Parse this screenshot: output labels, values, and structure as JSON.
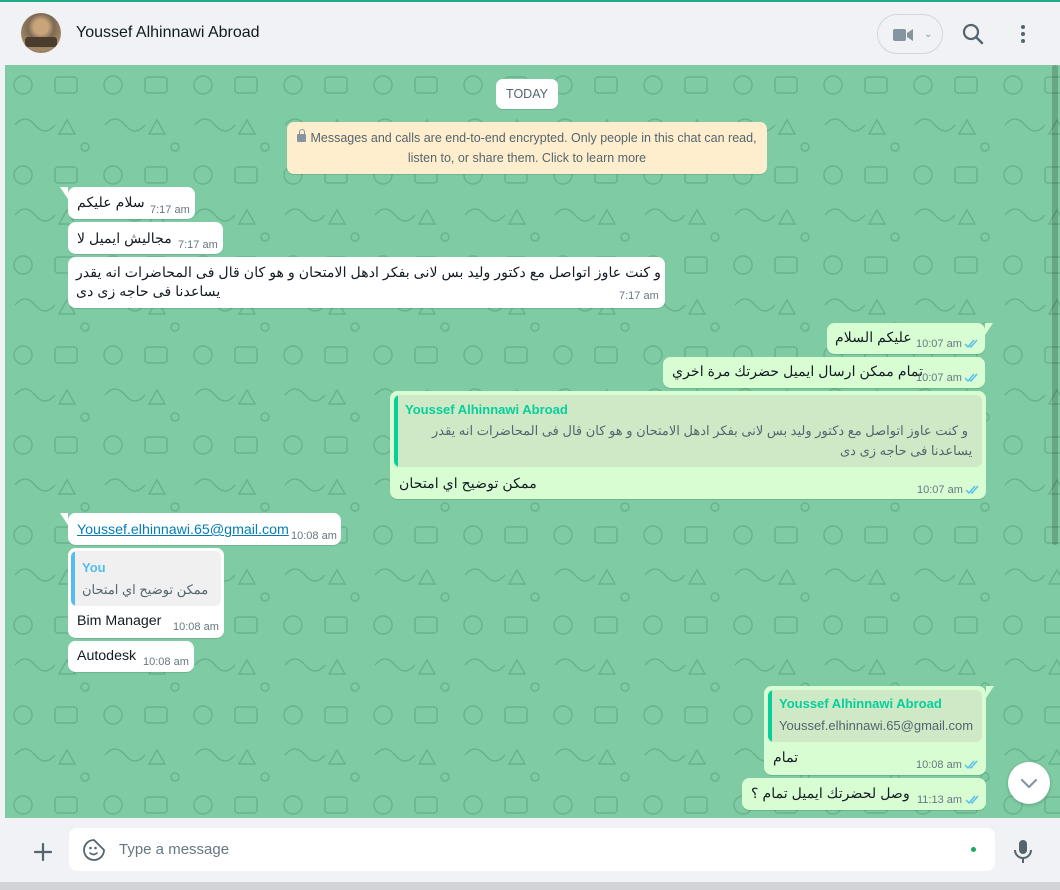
{
  "header": {
    "contact_name": "Youssef Alhinnawi Abroad"
  },
  "chat": {
    "day_chip": "TODAY",
    "encryption_line1": "Messages and calls are end-to-end encrypted. Only people in this chat can read,",
    "encryption_line2": "listen to, or share them. Click to learn more",
    "messages": [
      {
        "dir": "in",
        "text": "سلام عليكم",
        "time": "7:17 am"
      },
      {
        "dir": "in",
        "text": "مجاليش ايميل لا",
        "time": "7:17 am"
      },
      {
        "dir": "in",
        "line1": "و كنت عاوز اتواصل مع دكتور وليد بس لانى بفكر ادهل الامتحان و هو كان قال فى المحاضرات انه يقدر",
        "line2": "يساعدنا فى حاجه زى دى",
        "time": "7:17 am"
      },
      {
        "dir": "out",
        "text": "عليكم السلام",
        "time": "10:07 am"
      },
      {
        "dir": "out",
        "text": "تمام ممكن ارسال ايميل حضرتك مرة اخري",
        "time": "10:07 am"
      },
      {
        "dir": "out",
        "quote_name": "Youssef Alhinnawi Abroad",
        "quote_line1": "و كنت عاوز اتواصل مع دكتور وليد بس لانى بفكر ادهل الامتحان و هو كان قال فى المحاضرات انه يقدر",
        "quote_line2": "يساعدنا فى حاجه زى دى",
        "text": "ممكن توضيح اي امتحان",
        "time": "10:07 am"
      },
      {
        "dir": "in",
        "text": "Youssef.elhinnawi.65@gmail.com",
        "time": "10:08 am"
      },
      {
        "dir": "in",
        "quote_name": "You",
        "quote_text": "ممكن توضيح اي امتحان",
        "text": "Bim Manager",
        "time": "10:08 am"
      },
      {
        "dir": "in",
        "text": "Autodesk",
        "time": "10:08 am"
      },
      {
        "dir": "out",
        "quote_name": "Youssef Alhinnawi Abroad",
        "quote_text": "Youssef.elhinnawi.65@gmail.com",
        "text": "تمام",
        "time": "10:08 am"
      },
      {
        "dir": "out",
        "text": "وصل لحضرتك ايميل تمام ؟",
        "time": "11:13 am"
      }
    ]
  },
  "composer": {
    "placeholder": "Type a message"
  },
  "colors": {
    "chat_bg": "#7fcba3",
    "outgoing_bubble": "#d9fdd3",
    "incoming_bubble": "#ffffff",
    "read_ticks": "#53bdeb",
    "quote_name_out": "#06cf9c",
    "quote_name_in": "#53bdeb"
  },
  "icons": {
    "video": "video-call-icon",
    "search": "search-icon",
    "menu": "menu-dots-icon",
    "attach": "plus-icon",
    "sticker": "sticker-icon",
    "mic": "microphone-icon",
    "scroll": "chevron-down-icon"
  }
}
